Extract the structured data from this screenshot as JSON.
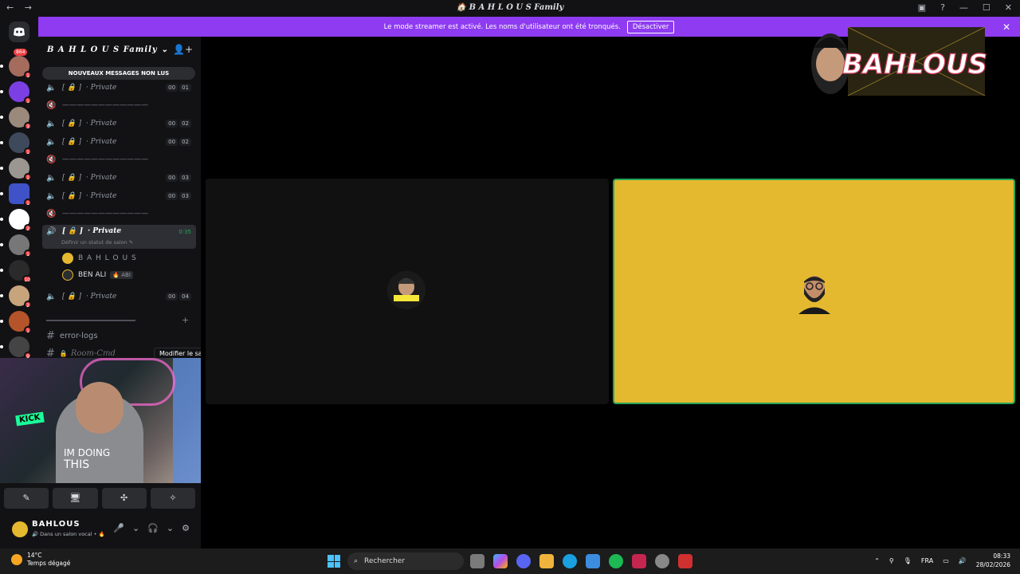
{
  "titlebar": {
    "title": "🏠 B A H L O U S Family",
    "back": "←",
    "forward": "→"
  },
  "banner": {
    "text": "Le mode streamer est activé. Les noms d'utilisateur ont été tronqués.",
    "button": "Désactiver",
    "close": "✕"
  },
  "servers": {
    "dm_badge": "864",
    "badges": [
      "1",
      "1",
      "3",
      "1",
      "1",
      "1",
      "2",
      "1",
      "10",
      "2",
      "1",
      "9"
    ]
  },
  "sidebar": {
    "guild_name": "B A H L O U S Family",
    "chevron": "⌄",
    "new_messages": "NOUVEAUX MESSAGES NON LUS",
    "channels": [
      {
        "name": "· Private",
        "lock": "[ 🔒 ]",
        "a": "00",
        "b": "01"
      },
      {
        "divider": "————————————"
      },
      {
        "name": "· Private",
        "lock": "[ 🔒 ]",
        "a": "00",
        "b": "02"
      },
      {
        "name": "· Private",
        "lock": "[ 🔒 ]",
        "a": "00",
        "b": "02"
      },
      {
        "divider": "————————————"
      },
      {
        "name": "· Private",
        "lock": "[ 🔒 ]",
        "a": "00",
        "b": "03"
      },
      {
        "name": "· Private",
        "lock": "[ 🔒 ]",
        "a": "00",
        "b": "03"
      },
      {
        "divider": "————————————"
      }
    ],
    "active_channel": {
      "name": "· Private",
      "lock": "[ 🔒 ]",
      "time": "0:35",
      "status": "Définir un statut de salon ✎"
    },
    "voice_users": [
      {
        "name": "B A H L O U S"
      },
      {
        "name": "BEN ALI",
        "tag": "🔥 ABI"
      }
    ],
    "last_channel": {
      "name": "· Private",
      "lock": "[ 🔒 ]",
      "a": "00",
      "b": "04"
    },
    "text_channels": [
      "error-logs",
      "Room-Cmd"
    ],
    "tooltip": "Modifier le salon"
  },
  "webcam": {
    "shirt_text_1": "IM DOING",
    "shirt_text_2": "THIS",
    "sign": "KICK"
  },
  "actions": [
    "✎",
    "🖥",
    "✣",
    "✧"
  ],
  "user": {
    "name": "BAHLOUS",
    "status": "🔊 Dans un salon vocal • 🔥"
  },
  "logo_text": "BAHLOUS",
  "taskbar": {
    "temp": "14°C",
    "weather": "Temps dégagé",
    "search": "Rechercher",
    "lang": "FRA",
    "time": "08:33",
    "date": "28/02/2026"
  }
}
